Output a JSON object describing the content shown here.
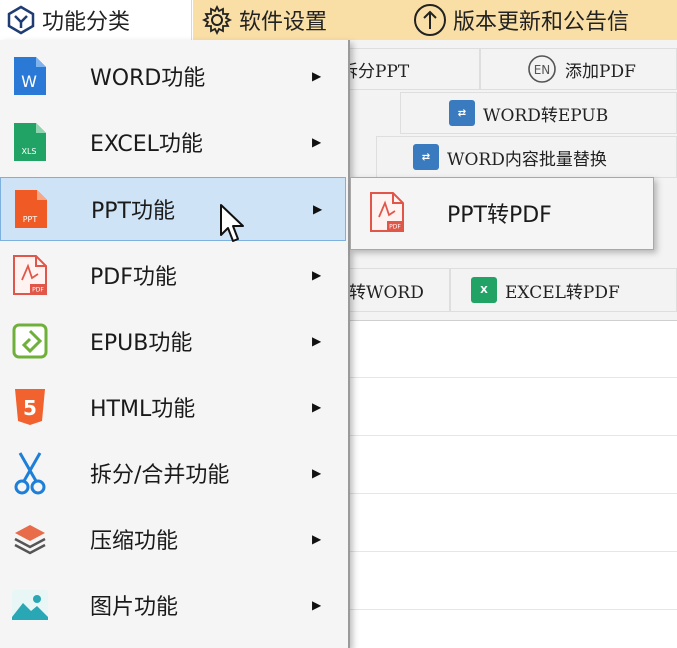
{
  "menubar": {
    "category_label": "功能分类",
    "settings_label": "软件设置",
    "update_label": "版本更新和公告信"
  },
  "toolbar": {
    "buttons": [
      {
        "label": "拆分PPT",
        "icon": "ppt-split-icon"
      },
      {
        "label": "添加PDF",
        "icon": "en-circle-icon"
      },
      {
        "label": "WORD转EPUB",
        "icon": "convert-icon"
      },
      {
        "label": "WORD内容批量替换",
        "icon": "convert-icon"
      },
      {
        "label": "转WORD",
        "icon": ""
      },
      {
        "label": "EXCEL转PDF",
        "icon": "excel-icon"
      }
    ]
  },
  "dropdown": {
    "items": [
      {
        "label": "WORD功能",
        "icon": "word-file-icon"
      },
      {
        "label": "EXCEL功能",
        "icon": "excel-file-icon"
      },
      {
        "label": "PPT功能",
        "icon": "ppt-file-icon"
      },
      {
        "label": "PDF功能",
        "icon": "pdf-file-icon"
      },
      {
        "label": "EPUB功能",
        "icon": "epub-icon"
      },
      {
        "label": "HTML功能",
        "icon": "html5-icon"
      },
      {
        "label": "拆分/合并功能",
        "icon": "scissors-icon"
      },
      {
        "label": "压缩功能",
        "icon": "layers-icon"
      },
      {
        "label": "图片功能",
        "icon": "image-icon"
      }
    ],
    "highlighted_index": 2
  },
  "submenu": {
    "items": [
      {
        "label": "PPT转PDF",
        "icon": "pdf-file-icon"
      }
    ]
  },
  "colors": {
    "menubar_accent": "#f9dfa6",
    "highlight": "#cfe3f6",
    "highlight_border": "#7eb0dd",
    "word_blue": "#2b79d6",
    "excel_green": "#21a366",
    "ppt_orange": "#f05a24",
    "pdf_red": "#e0574a",
    "epub_green": "#6fb03a",
    "html_orange": "#f2622e",
    "scissors_blue": "#1e7fd8"
  }
}
